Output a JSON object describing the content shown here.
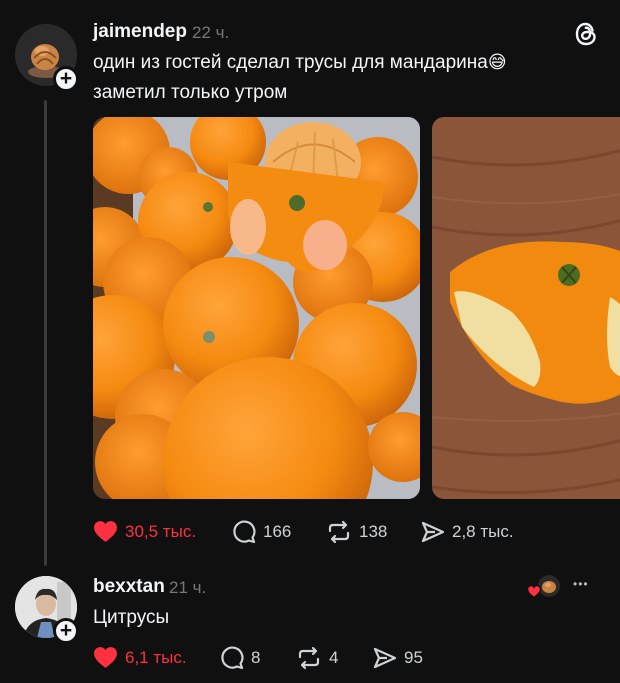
{
  "post": {
    "username": "jaimendep",
    "time": "22 ч.",
    "line1": "один из гостей сделал трусы для мандарина",
    "emoji": "😅",
    "line2": "заметил только утром",
    "likes": "30,5 тыс.",
    "replies": "166",
    "reposts": "138",
    "shares": "2,8 тыс."
  },
  "reply": {
    "username": "bexxtan",
    "time": "21 ч.",
    "text": "Цитрусы",
    "likes": "6,1 тыс.",
    "replies": "8",
    "reposts": "4",
    "shares": "95",
    "more": "•••"
  },
  "colors": {
    "like_red": "#ff3040",
    "orange": "#f08c1a",
    "background": "#101010"
  },
  "icons": [
    "threads-logo-icon",
    "heart-icon",
    "comment-icon",
    "repost-icon",
    "share-icon",
    "more-icon"
  ]
}
